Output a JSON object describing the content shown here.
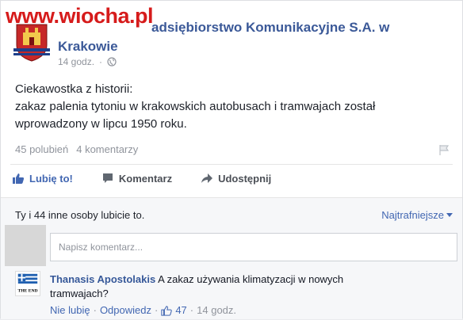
{
  "watermark": "www.wiocha.pl",
  "post": {
    "page_name": "Miejskie Przedsiębiorstwo Komunikacyjne S.A. w Krakowie",
    "page_name_line1": "...ebiorstwo Przedsiębiorstwo Komunikacyjne S.A. w",
    "page_name_line1_visible": "adsiębiorstwo Komunikacyjne S.A. w",
    "page_name_line2": "Krakowie",
    "time": "14 godz.",
    "text_lines": [
      "Ciekawostka z historii:",
      "zakaz palenia tytoniu w krakowskich autobusach i tramwajach został",
      "wprowadzony w lipcu 1950 roku."
    ],
    "likes": "45 polubień",
    "comments_count": "4 komentarzy"
  },
  "actions": {
    "like": "Lubię to!",
    "comment": "Komentarz",
    "share": "Udostępnij"
  },
  "comments_section": {
    "likes_line": "Ty i 44 inne osoby lubicie to.",
    "sort_label": "Najtrafniejsze",
    "input_placeholder": "Napisz komentarz...",
    "comment": {
      "author": "Thanasis Apostolakis",
      "text": "A zakaz używania klimatyzacji w nowych tramwajach?",
      "reply_unlike": "Nie lubię",
      "reply": "Odpowiedz",
      "like_count": "47",
      "time": "14 godz.",
      "avatar_label": "THE END"
    }
  },
  "colors": {
    "link": "#3b5998",
    "accent": "#4267b2",
    "muted": "#90949c",
    "watermark": "#d61b1b"
  }
}
